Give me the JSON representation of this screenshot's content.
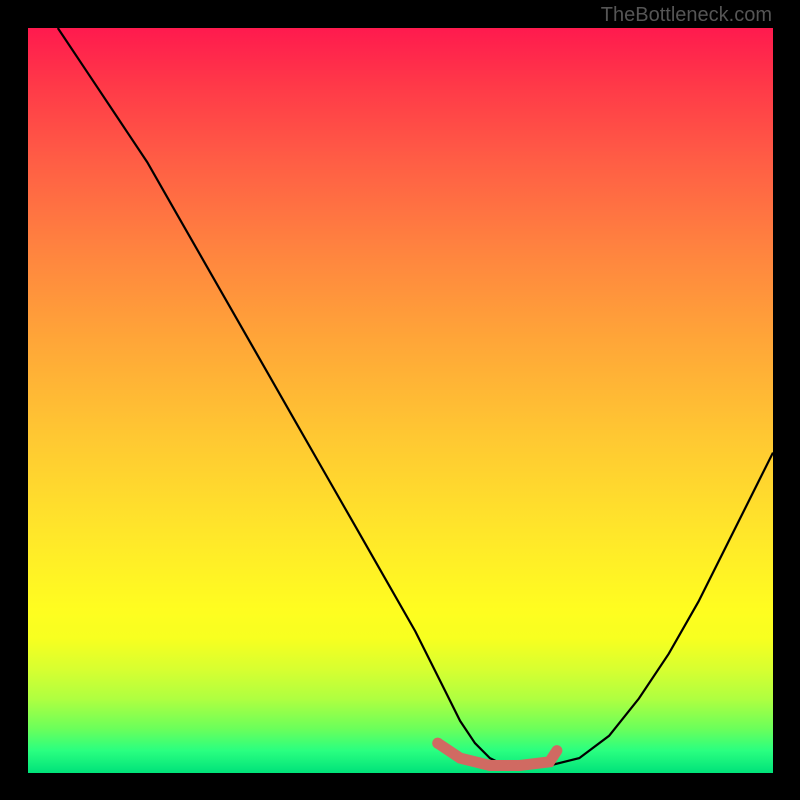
{
  "attribution": "TheBottleneck.com",
  "chart_data": {
    "type": "line",
    "title": "",
    "xlabel": "",
    "ylabel": "",
    "xlim": [
      0,
      100
    ],
    "ylim": [
      0,
      100
    ],
    "series": [
      {
        "name": "bottleneck-curve",
        "x": [
          4,
          8,
          12,
          16,
          20,
          24,
          28,
          32,
          36,
          40,
          44,
          48,
          52,
          54,
          56,
          58,
          60,
          62,
          64,
          66,
          68,
          70,
          74,
          78,
          82,
          86,
          90,
          94,
          98,
          100
        ],
        "y": [
          100,
          94,
          88,
          82,
          75,
          68,
          61,
          54,
          47,
          40,
          33,
          26,
          19,
          15,
          11,
          7,
          4,
          2,
          1,
          1,
          1,
          1,
          2,
          5,
          10,
          16,
          23,
          31,
          39,
          43
        ]
      },
      {
        "name": "optimal-zone-marker",
        "x": [
          55,
          58,
          62,
          66,
          70,
          71
        ],
        "y": [
          4,
          2,
          1,
          1,
          1.5,
          3
        ]
      }
    ],
    "gradient_stops": [
      {
        "pos": 0.0,
        "color": "#ff1a4e"
      },
      {
        "pos": 0.18,
        "color": "#ff5e45"
      },
      {
        "pos": 0.42,
        "color": "#ffa638"
      },
      {
        "pos": 0.68,
        "color": "#ffe72a"
      },
      {
        "pos": 0.86,
        "color": "#d8ff30"
      },
      {
        "pos": 1.0,
        "color": "#00e27a"
      }
    ],
    "marker_color": "#d06a62"
  }
}
